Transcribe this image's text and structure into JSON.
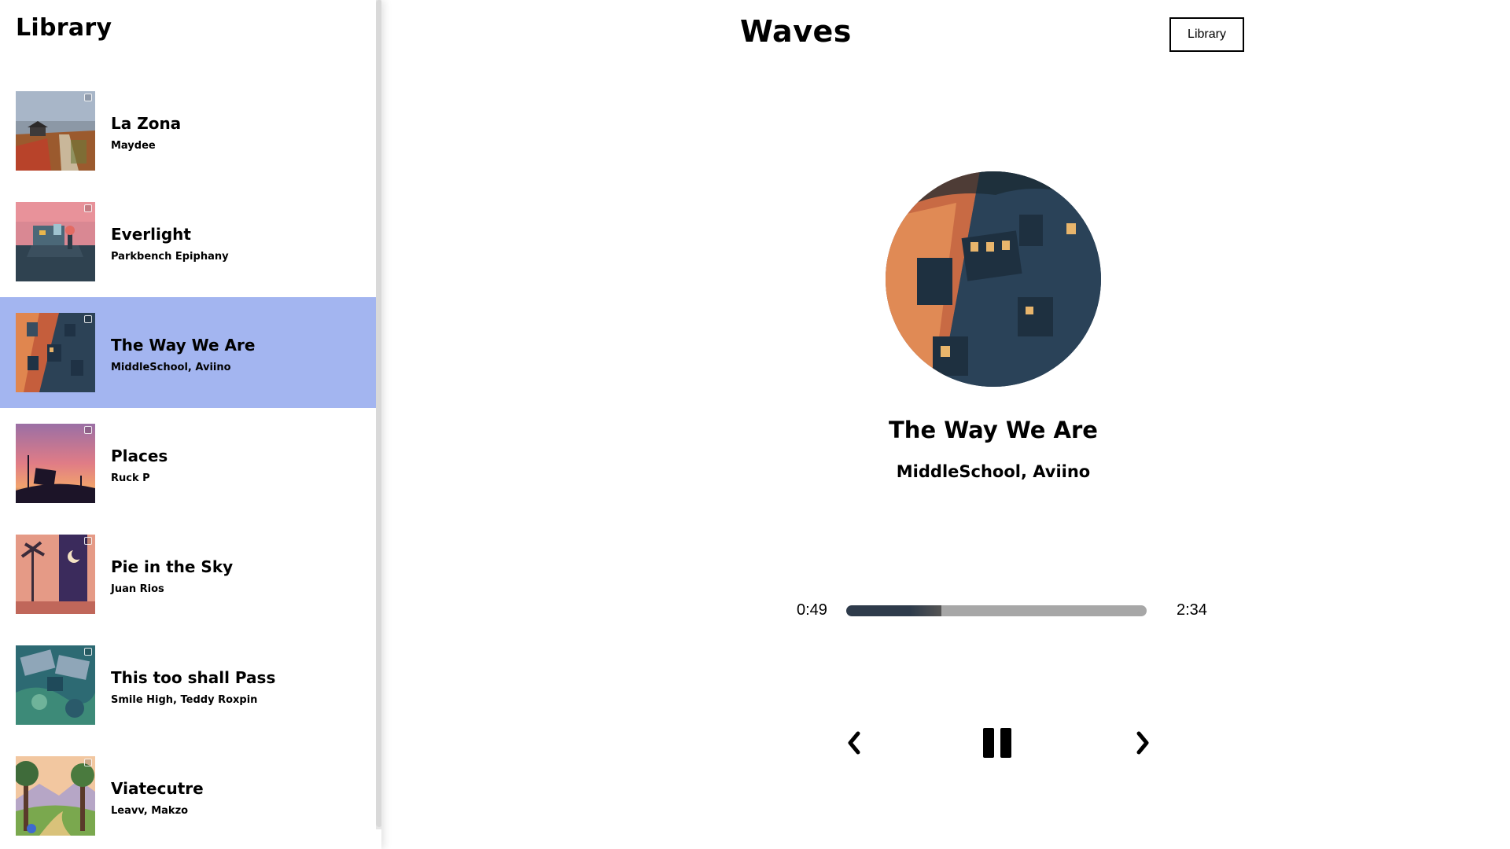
{
  "sidebar": {
    "title": "Library",
    "songs": [
      {
        "name": "La Zona",
        "artist": "Maydee",
        "active": false
      },
      {
        "name": "Everlight",
        "artist": "Parkbench Epiphany",
        "active": false
      },
      {
        "name": "The Way We Are",
        "artist": "MiddleSchool, Aviino",
        "active": true
      },
      {
        "name": "Places",
        "artist": "Ruck P",
        "active": false
      },
      {
        "name": "Pie in the Sky",
        "artist": "Juan Rios",
        "active": false
      },
      {
        "name": "This too shall Pass",
        "artist": "Smile High, Teddy Roxpin",
        "active": false
      },
      {
        "name": "Viatecutre",
        "artist": "Leavv, Makzo",
        "active": false
      }
    ]
  },
  "header": {
    "title": "Waves",
    "library_button_label": "Library"
  },
  "now_playing": {
    "title": "The Way We Are",
    "artist": "MiddleSchool, Aviino"
  },
  "player": {
    "current_time": "0:49",
    "total_time": "2:34",
    "progress_fraction": 0.318
  },
  "controls": {
    "prev_icon": "chevron-left-icon",
    "play_pause_icon": "pause-icon",
    "next_icon": "chevron-right-icon"
  },
  "colors": {
    "active_item": "#a3b5f0",
    "progress_fill": "#2e3b4b",
    "progress_track": "#a7a7a7"
  }
}
